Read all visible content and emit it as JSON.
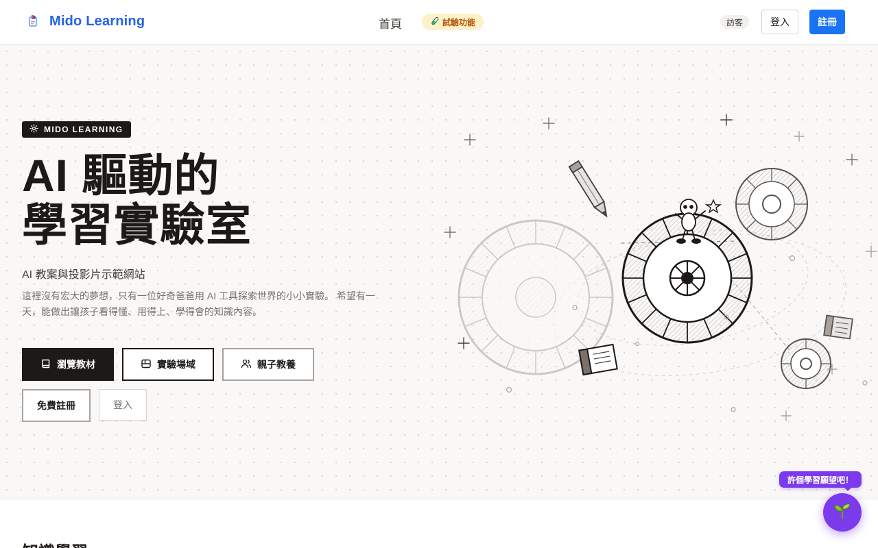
{
  "header": {
    "brand": "Mido Learning",
    "nav_home": "首頁",
    "experimental_badge": "試驗功能",
    "visitor_badge": "訪客",
    "login_label": "登入",
    "register_label": "註冊"
  },
  "hero": {
    "kicker": "MIDO LEARNING",
    "headline_line1": "AI 驅動的",
    "headline_line2": "學習實驗室",
    "subtitle": "AI 教案與投影片示範網站",
    "description": "這裡沒有宏大的夢想，只有一位好奇爸爸用 AI 工具探索世界的小小實驗。 希望有一天，能做出讓孩子看得懂、用得上、學得會的知識內容。",
    "buttons": {
      "browse": "瀏覽教材",
      "playground": "實驗場域",
      "parenting": "親子教養",
      "free_register": "免費註冊",
      "login": "登入"
    }
  },
  "section": {
    "title": "知識學習"
  },
  "wish_widget": {
    "bubble": "許個學習願望吧！",
    "icon": "sprout-icon"
  },
  "colors": {
    "brand_blue": "#2563eb",
    "register_blue": "#1a73f5",
    "wish_purple": "#7c3aed",
    "dark": "#1c1917",
    "badge_yellow": "#fdf1c7"
  }
}
